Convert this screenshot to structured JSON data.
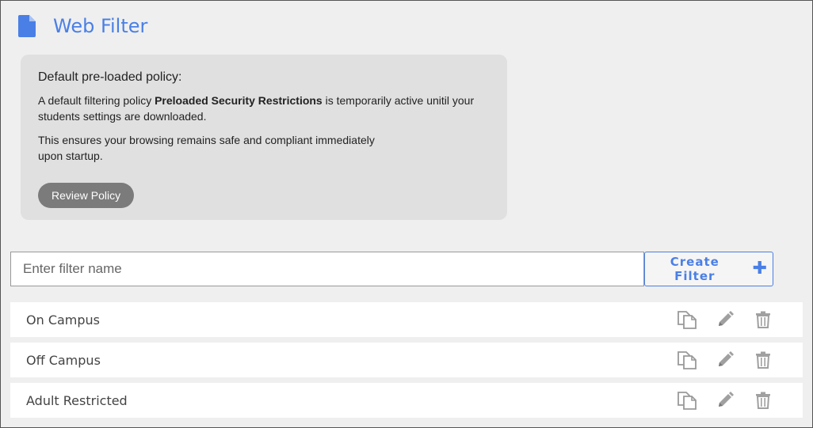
{
  "header": {
    "title": "Web Filter",
    "icon": "document-icon",
    "accent": "#4a7fe6"
  },
  "notice": {
    "heading": "Default pre-loaded policy:",
    "p1_before": "A default filtering policy ",
    "p1_bold": "Preloaded Security Restrictions",
    "p1_after": " is temporarily active unitil your students settings are downloaded.",
    "p2": "This ensures your browsing remains safe and compliant immediately upon startup.",
    "review_label": "Review Policy"
  },
  "search": {
    "placeholder": "Enter filter name",
    "value": ""
  },
  "create": {
    "label": "Create Filter",
    "icon": "plus-icon"
  },
  "filters": [
    {
      "name": "On Campus"
    },
    {
      "name": "Off Campus"
    },
    {
      "name": "Adult Restricted"
    }
  ],
  "row_actions": [
    "copy-icon",
    "edit-icon",
    "delete-icon"
  ]
}
